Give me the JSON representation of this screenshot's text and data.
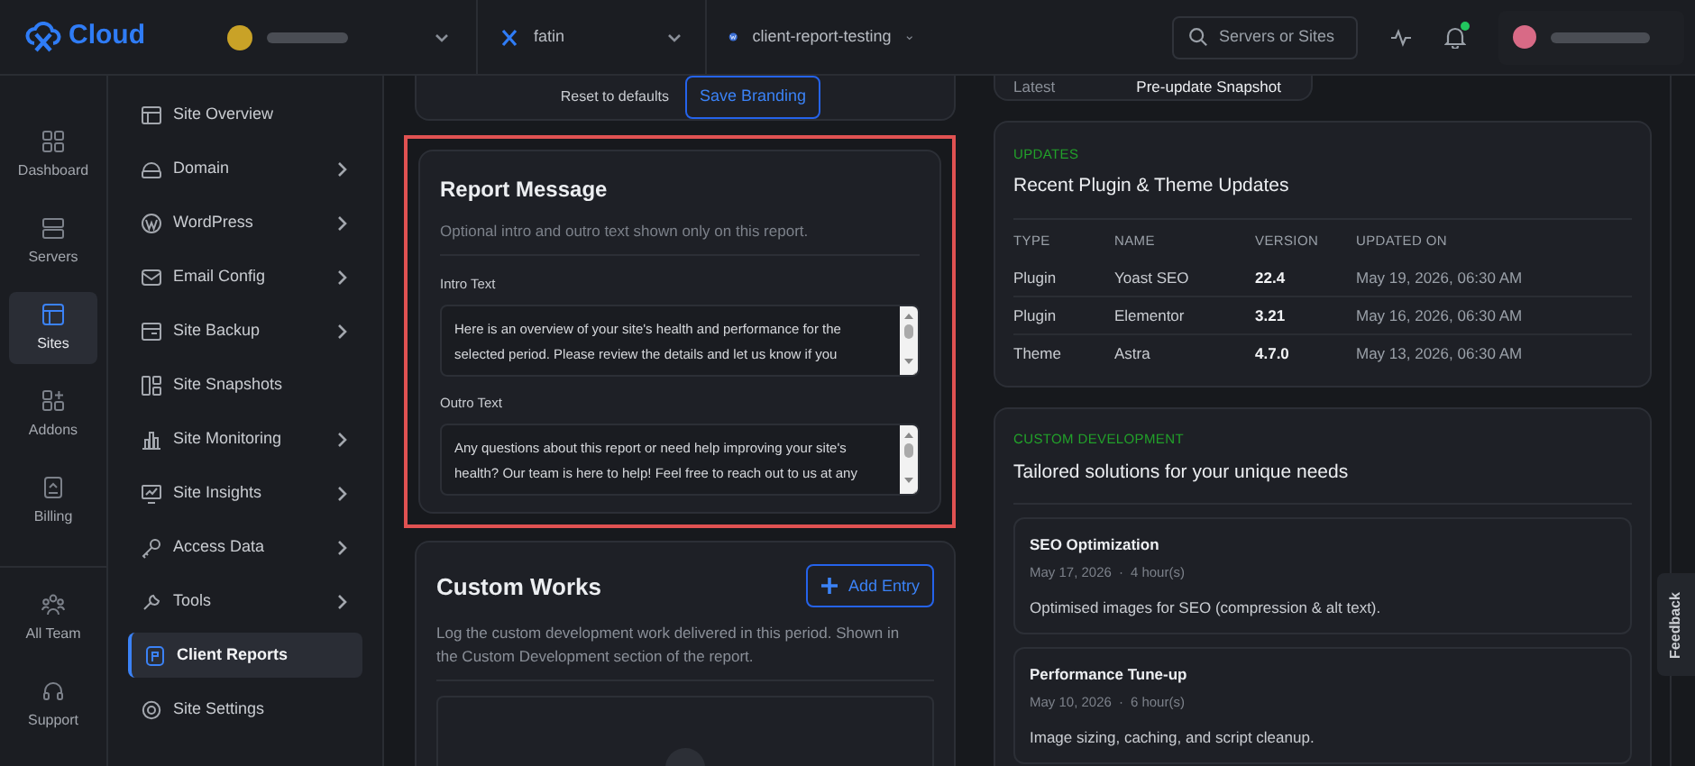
{
  "brand": {
    "name": "Cloud"
  },
  "breadcrumbs": [
    {
      "label": "fatin",
      "kind": "server"
    },
    {
      "label": "client-report-testing",
      "kind": "site"
    }
  ],
  "search": {
    "placeholder": "Servers or Sites"
  },
  "notifications": {
    "unread": true
  },
  "rail": [
    {
      "label": "Dashboard",
      "selected": false
    },
    {
      "label": "Servers",
      "selected": false
    },
    {
      "label": "Sites",
      "selected": true
    },
    {
      "label": "Addons",
      "selected": false
    },
    {
      "label": "Billing",
      "selected": false
    },
    {
      "label": "All Team",
      "selected": false
    },
    {
      "label": "Support",
      "selected": false
    }
  ],
  "site_nav": [
    {
      "label": "Site Overview",
      "expandable": false,
      "selected": false
    },
    {
      "label": "Domain",
      "expandable": true,
      "selected": false
    },
    {
      "label": "WordPress",
      "expandable": true,
      "selected": false
    },
    {
      "label": "Email Config",
      "expandable": true,
      "selected": false
    },
    {
      "label": "Site Backup",
      "expandable": true,
      "selected": false
    },
    {
      "label": "Site Snapshots",
      "expandable": false,
      "selected": false
    },
    {
      "label": "Site Monitoring",
      "expandable": true,
      "selected": false
    },
    {
      "label": "Site Insights",
      "expandable": true,
      "selected": false
    },
    {
      "label": "Access Data",
      "expandable": true,
      "selected": false
    },
    {
      "label": "Tools",
      "expandable": true,
      "selected": false
    },
    {
      "label": "Client Reports",
      "expandable": false,
      "selected": true
    },
    {
      "label": "Site Settings",
      "expandable": false,
      "selected": false
    }
  ],
  "branding": {
    "reset_link": "Reset to defaults",
    "save_button": "Save Branding"
  },
  "report_message": {
    "highlighted": true,
    "title": "Report Message",
    "subtitle": "Optional intro and outro text shown only on this report.",
    "fields": [
      {
        "label": "Intro Text",
        "value": "Here is an overview of your site's health and performance for the selected period. Please review the details and let us know if you"
      },
      {
        "label": "Outro Text",
        "value": "Any questions about this report or need help improving your site's health? Our team is here to help! Feel free to reach out to us at any"
      }
    ]
  },
  "custom_works": {
    "title": "Custom Works",
    "add_button": "Add Entry",
    "description": "Log the custom development work delivered in this period. Shown in the Custom Development section of the report."
  },
  "snapshot": {
    "label": "Latest",
    "value": "Pre-update Snapshot"
  },
  "updates": {
    "eyebrow": "UPDATES",
    "title": "Recent Plugin & Theme Updates",
    "columns": [
      "TYPE",
      "NAME",
      "VERSION",
      "UPDATED ON"
    ],
    "rows": [
      [
        "Plugin",
        "Yoast SEO",
        "22.4",
        "May 19, 2026, 06:30 AM"
      ],
      [
        "Plugin",
        "Elementor",
        "3.21",
        "May 16, 2026, 06:30 AM"
      ],
      [
        "Theme",
        "Astra",
        "4.7.0",
        "May 13, 2026, 06:30 AM"
      ]
    ]
  },
  "custom_development": {
    "eyebrow": "CUSTOM DEVELOPMENT",
    "title": "Tailored solutions for your unique needs",
    "entries": [
      {
        "title": "SEO Optimization",
        "date": "May 17, 2026",
        "separator": "·",
        "duration": "4 hour(s)",
        "description": "Optimised images for SEO (compression & alt text)."
      },
      {
        "title": "Performance Tune-up",
        "date": "May 10, 2026",
        "separator": "·",
        "duration": "6 hour(s)",
        "description": "Image sizing, caching, and script cleanup."
      }
    ]
  },
  "feedback": "Feedback"
}
